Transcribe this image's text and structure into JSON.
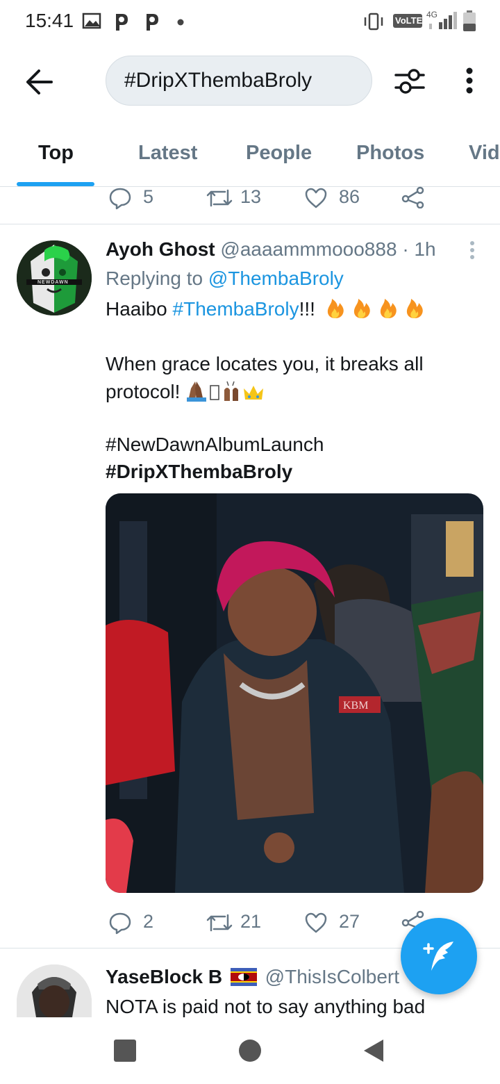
{
  "status_bar": {
    "time": "15:41",
    "network_label": "VoLTE",
    "network_type": "4G"
  },
  "search": {
    "query": "#DripXThembaBroly"
  },
  "tabs": [
    {
      "label": "Top",
      "active": true
    },
    {
      "label": "Latest",
      "active": false
    },
    {
      "label": "People",
      "active": false
    },
    {
      "label": "Photos",
      "active": false
    },
    {
      "label": "Vid",
      "active": false
    }
  ],
  "prev_tweet_actions": {
    "replies": "5",
    "retweets": "13",
    "likes": "86"
  },
  "tweet": {
    "display_name": "Ayoh Ghost",
    "handle": "@aaaammmooo888",
    "separator": "·",
    "time": "1h",
    "replying_prefix": "Replying to",
    "replying_to": "@ThembaBroly",
    "line1_prefix": "Haaibo",
    "line1_hashtag": "#ThembaBroly",
    "line1_suffix": "!!!",
    "line2": "When grace locates you, it breaks all",
    "line3": "protocol!",
    "hashtag1": "#NewDawnAlbumLaunch",
    "hashtag2": "#DripXThembaBroly",
    "jacket_text": "KBM",
    "avatar_text": "NEWDAWN",
    "actions": {
      "replies": "2",
      "retweets": "21",
      "likes": "27"
    }
  },
  "next_tweet": {
    "display_name": "YaseBlock B",
    "handle": "@ThisIsColbert",
    "text": "NOTA is paid not to say anything bad"
  },
  "colors": {
    "accent": "#1da1f2",
    "link": "#1b95e0",
    "muted": "#657786",
    "text": "#14171a"
  },
  "icons": [
    "back-arrow-icon",
    "filter-icon",
    "more-vertical-icon",
    "reply-icon",
    "retweet-icon",
    "like-icon",
    "share-icon",
    "compose-icon"
  ]
}
